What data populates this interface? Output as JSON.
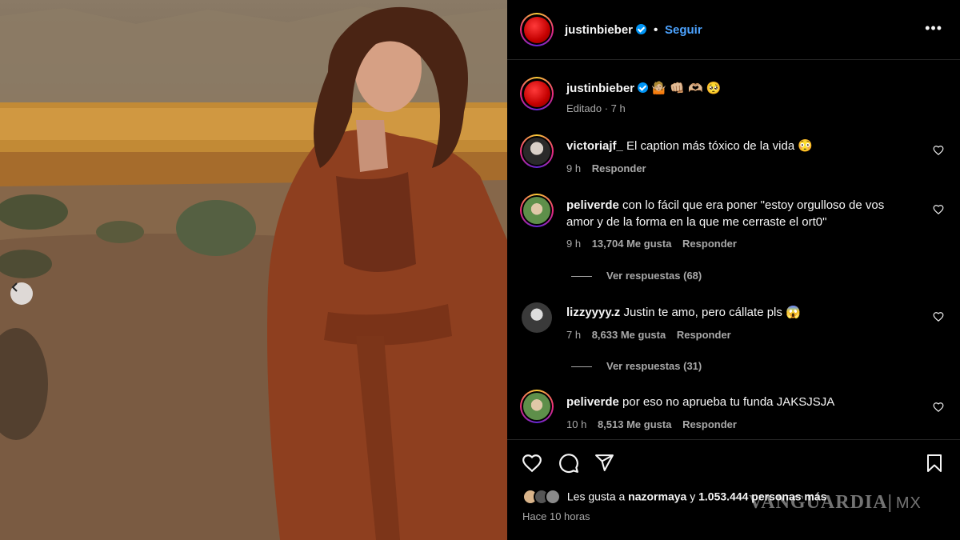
{
  "header": {
    "username": "justinbieber",
    "separator": "•",
    "follow_label": "Seguir",
    "more_icon": "more-dots-icon"
  },
  "caption": {
    "username": "justinbieber",
    "emojis": "🤷🏼 👊🏼 🫶🏼 🥺",
    "edited": "Editado · 7 h"
  },
  "comments": [
    {
      "username": "victoriajf_",
      "text": "El caption más tóxico de la vida 😳",
      "time": "9 h",
      "likes": "",
      "reply_label": "Responder"
    },
    {
      "username": "peliverde",
      "text": "con lo fácil que era poner \"estoy orgulloso de vos amor y de la forma en la que me cerraste el ort0\"",
      "time": "9 h",
      "likes": "13,704 Me gusta",
      "reply_label": "Responder",
      "view_replies": "Ver respuestas (68)"
    },
    {
      "username": "lizzyyyy.z",
      "text": "Justin te amo, pero cállate pls 😱",
      "time": "7 h",
      "likes": "8,633 Me gusta",
      "reply_label": "Responder",
      "view_replies": "Ver respuestas (31)"
    },
    {
      "username": "peliverde",
      "text": "por eso no aprueba tu funda JAKSJSJA",
      "time": "10 h",
      "likes": "8,513 Me gusta",
      "reply_label": "Responder"
    }
  ],
  "actions": {
    "like_icon": "heart-icon",
    "comment_icon": "comment-icon",
    "share_icon": "send-icon",
    "save_icon": "bookmark-icon"
  },
  "likes_line": {
    "prefix": "Les gusta a",
    "user": "nazormaya",
    "connector": "y",
    "count": "1.053.444 personas más"
  },
  "timestamp": "Hace 10 horas",
  "watermark": {
    "brand": "VANGUARDIA",
    "suffix": "MX"
  },
  "colors": {
    "accent_blue": "#0095f6",
    "follow_blue": "#4ca3ff",
    "muted": "#a8a8a8",
    "background": "#000000"
  }
}
